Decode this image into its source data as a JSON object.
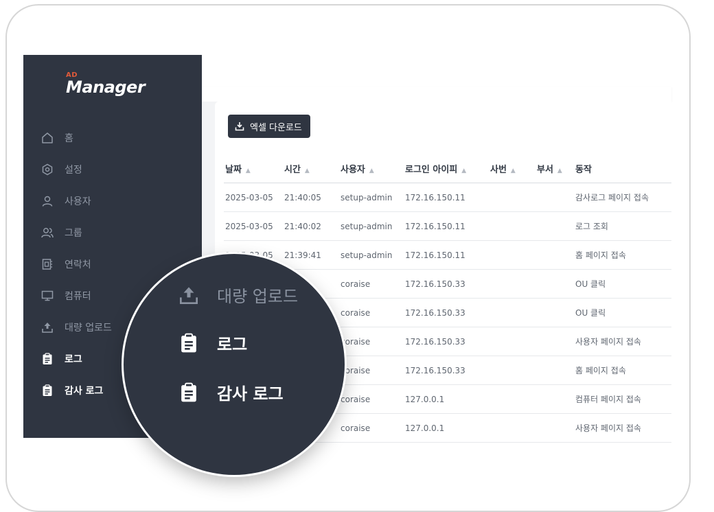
{
  "logo": {
    "small": "AD",
    "main": "Manager"
  },
  "sidebar": {
    "items": [
      {
        "label": "홈",
        "icon": "home-icon"
      },
      {
        "label": "설정",
        "icon": "gear-icon"
      },
      {
        "label": "사용자",
        "icon": "user-icon"
      },
      {
        "label": "그룹",
        "icon": "users-icon"
      },
      {
        "label": "연락처",
        "icon": "contact-book-icon"
      },
      {
        "label": "컴퓨터",
        "icon": "monitor-icon"
      },
      {
        "label": "대량 업로드",
        "icon": "upload-icon"
      },
      {
        "label": "로그",
        "icon": "clipboard-icon"
      },
      {
        "label": "감사 로그",
        "icon": "clipboard-icon"
      }
    ]
  },
  "toolbar": {
    "excel_label": "엑셀 다운로드"
  },
  "table": {
    "headers": [
      "날짜",
      "시간",
      "사용자",
      "로그인 아이피",
      "사번",
      "부서",
      "동작"
    ],
    "rows": [
      [
        "2025-03-05",
        "21:40:05",
        "setup-admin",
        "172.16.150.11",
        "",
        "",
        "감사로그 페이지 접속"
      ],
      [
        "2025-03-05",
        "21:40:02",
        "setup-admin",
        "172.16.150.11",
        "",
        "",
        "로그 조회"
      ],
      [
        "2025-03-05",
        "21:39:41",
        "setup-admin",
        "172.16.150.11",
        "",
        "",
        "홈 페이지 접속"
      ],
      [
        "",
        ":30",
        "coraise",
        "172.16.150.33",
        "",
        "",
        "OU 클릭"
      ],
      [
        "",
        "",
        "coraise",
        "172.16.150.33",
        "",
        "",
        "OU 클릭"
      ],
      [
        "",
        "",
        "coraise",
        "172.16.150.33",
        "",
        "",
        "사용자 페이지 접속"
      ],
      [
        "",
        "",
        "coraise",
        "172.16.150.33",
        "",
        "",
        "홈 페이지 접속"
      ],
      [
        "",
        "",
        "coraise",
        "127.0.0.1",
        "",
        "",
        "컴퓨터 페이지 접속"
      ],
      [
        "",
        "",
        "coraise",
        "127.0.0.1",
        "",
        "",
        "사용자 페이지 접속"
      ]
    ]
  },
  "magnifier": {
    "items": [
      {
        "label": "대량 업로드",
        "icon": "upload-icon"
      },
      {
        "label": "로그",
        "icon": "clipboard-icon"
      },
      {
        "label": "감사 로그",
        "icon": "clipboard-icon"
      }
    ]
  },
  "colors": {
    "sidebar_bg": "#2f3541",
    "logo_accent": "#e05a3a",
    "nav_inactive": "#9098a5"
  }
}
